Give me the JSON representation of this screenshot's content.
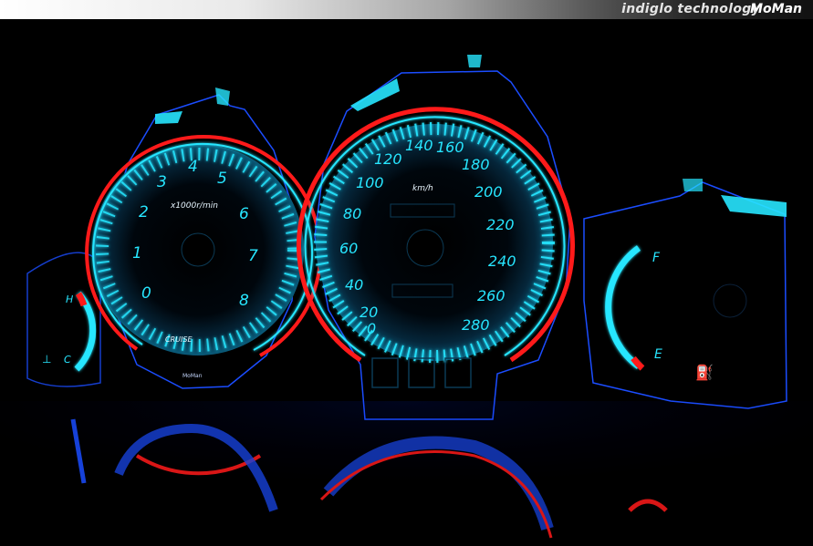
{
  "banner": {
    "text": "indiglo technology",
    "brand": "MoMan"
  },
  "tachometer": {
    "unit_label": "x1000r/min",
    "ticks": [
      "0",
      "1",
      "2",
      "3",
      "4",
      "5",
      "6",
      "7",
      "8"
    ],
    "indicator_label": "CRUISE",
    "maker_mark": "MoMan"
  },
  "speedometer": {
    "unit_label": "km/h",
    "ticks": [
      "0",
      "20",
      "40",
      "60",
      "80",
      "100",
      "120",
      "140",
      "160",
      "180",
      "200",
      "220",
      "240",
      "260",
      "280"
    ]
  },
  "fuel_gauge": {
    "full_label": "F",
    "empty_label": "E"
  },
  "temp_gauge": {
    "hot_label": "H",
    "cold_label": "C"
  },
  "colors": {
    "dial_glow": "#27e6ff",
    "redline": "#ff1a1a",
    "bezel": "#1b4dff",
    "background": "#000000"
  }
}
